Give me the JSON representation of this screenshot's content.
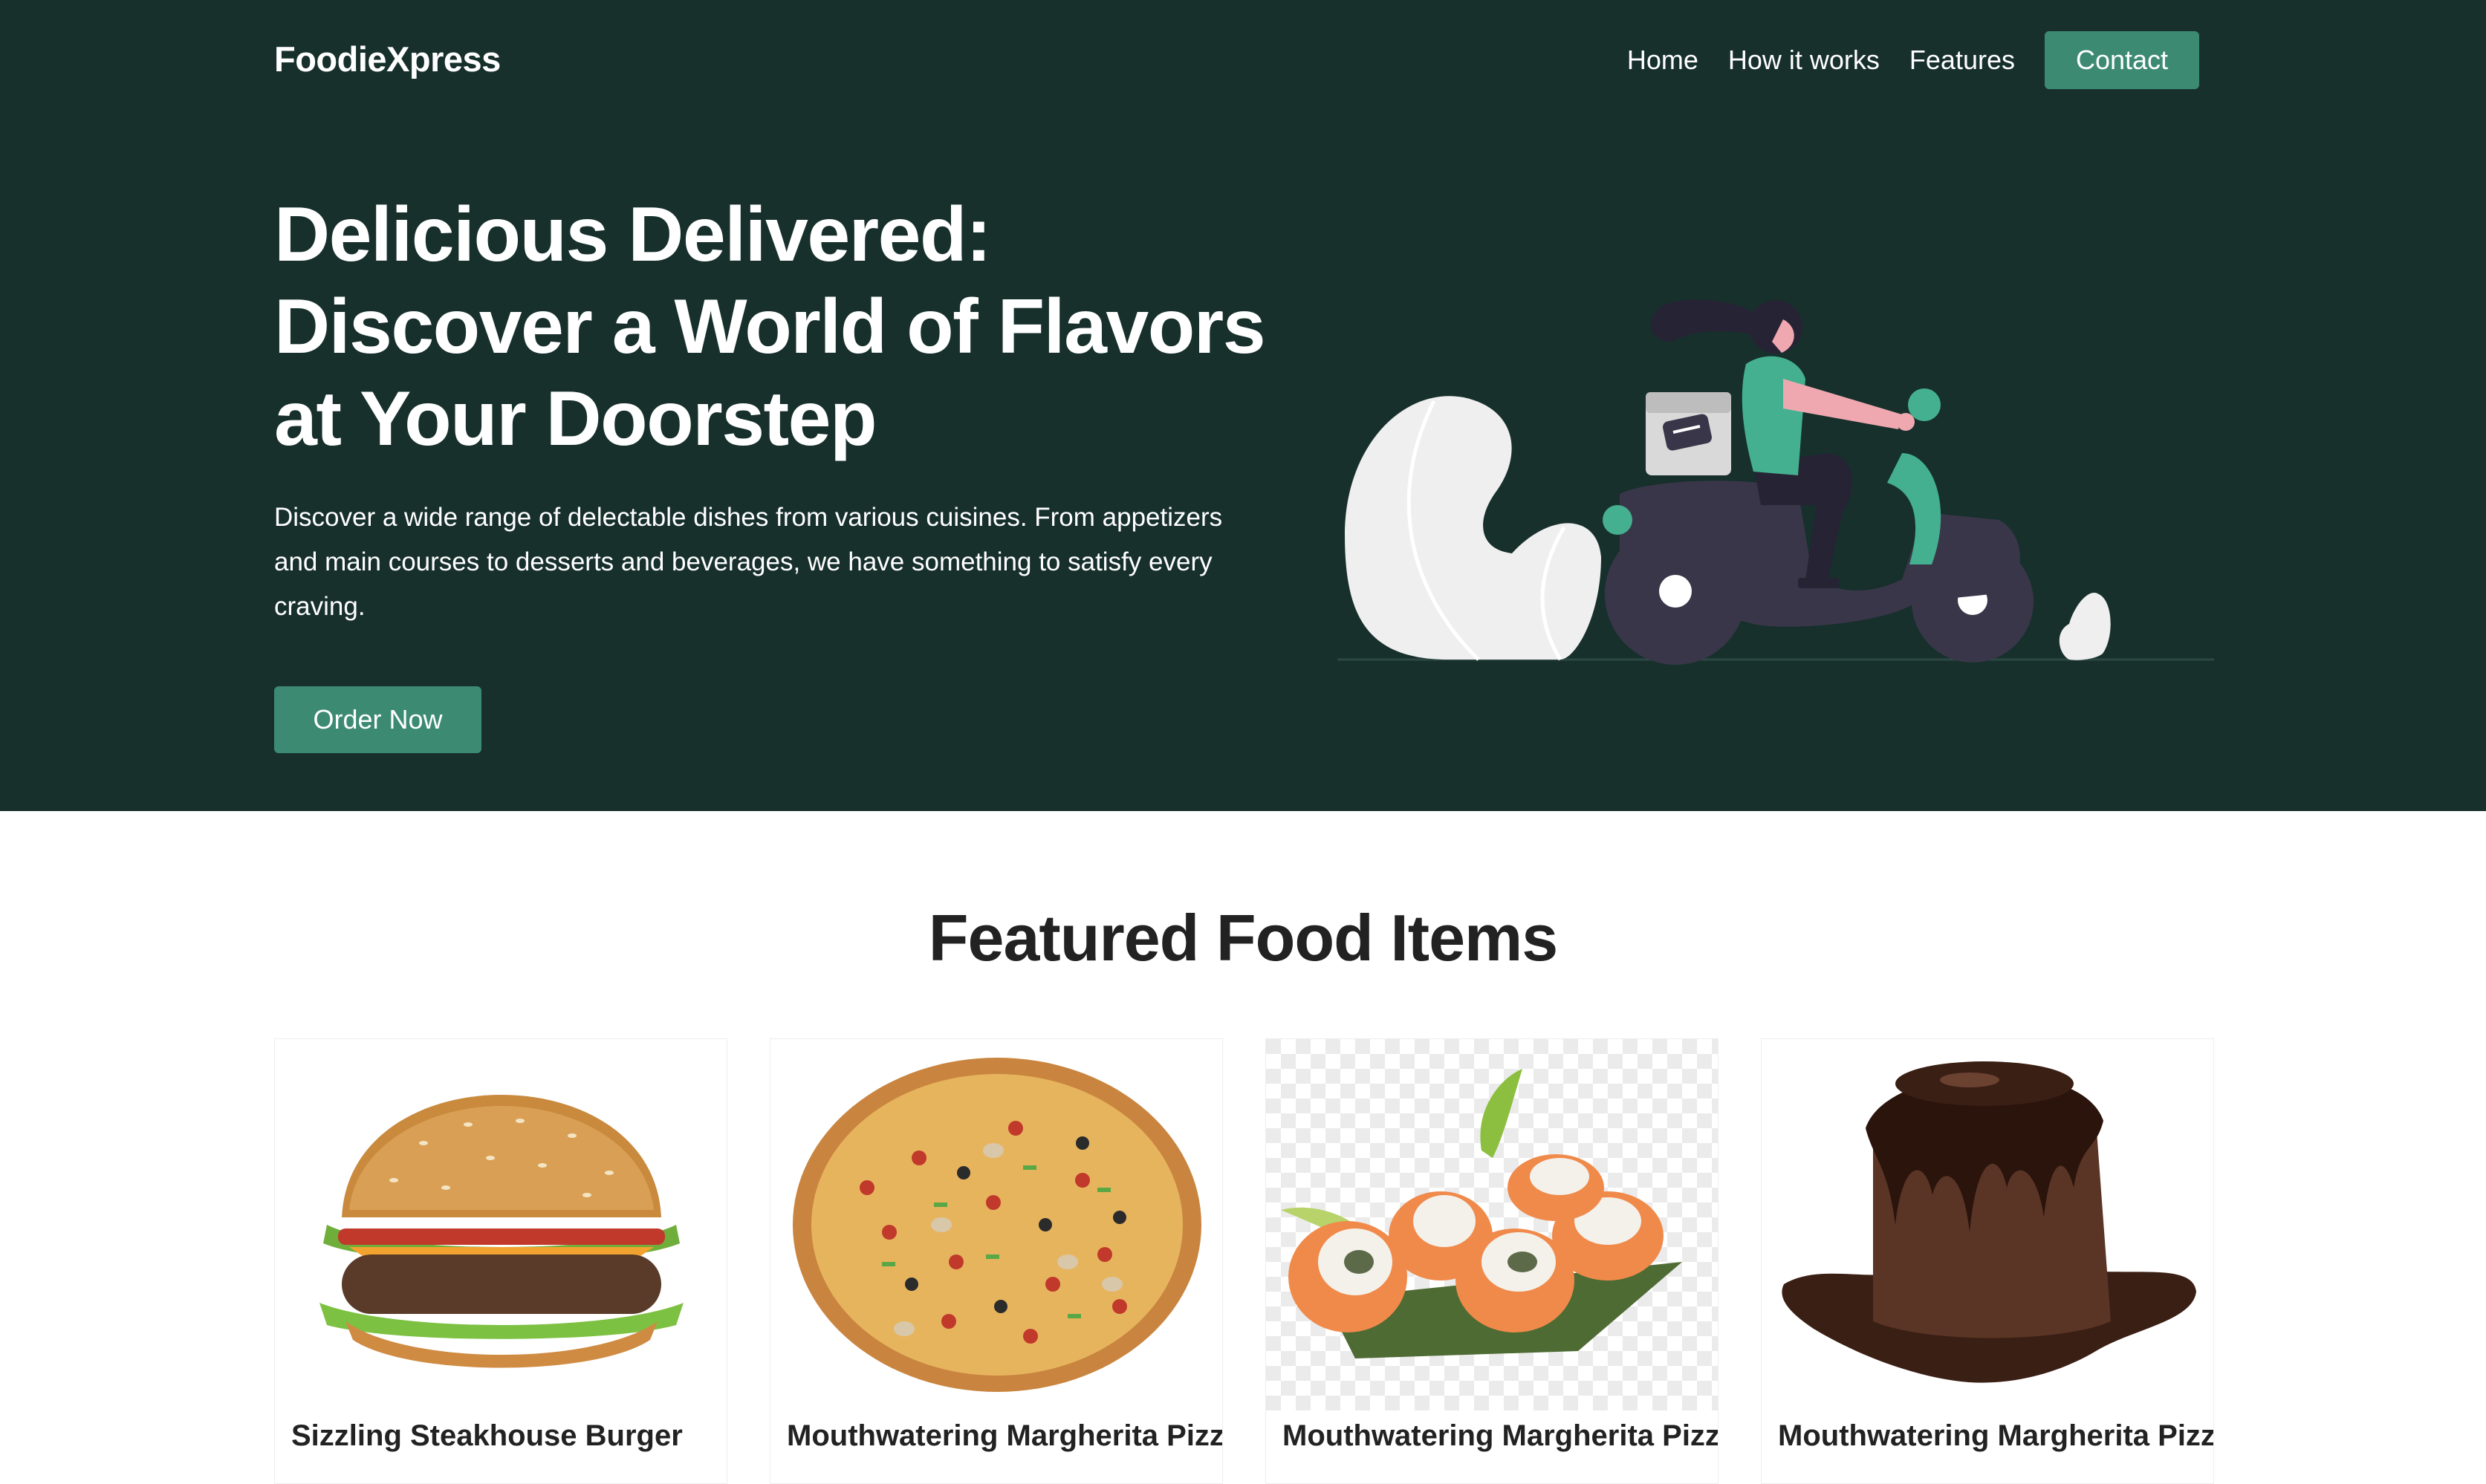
{
  "header": {
    "brand": "FoodieXpress",
    "nav": [
      "Home",
      "How it works",
      "Features"
    ],
    "contact_label": "Contact"
  },
  "hero": {
    "headline": "Delicious Delivered: Discover a World of Flavors at Your Doorstep",
    "description": "Discover a wide range of delectable dishes from various cuisines. From appetizers and main courses to desserts and beverages, we have something to satisfy every craving.",
    "cta_label": "Order Now"
  },
  "featured": {
    "title": "Featured Food Items",
    "items": [
      {
        "name": "Sizzling Steakhouse Burger",
        "image": "burger"
      },
      {
        "name": "Mouthwatering Margherita Pizza",
        "image": "pizza"
      },
      {
        "name": "Mouthwatering Margherita Pizza",
        "image": "sushi"
      },
      {
        "name": "Mouthwatering Margherita Pizza",
        "image": "lava-cake"
      }
    ]
  },
  "colors": {
    "hero_bg": "#17302c",
    "accent": "#3d8a72",
    "scooter": "#3a3649",
    "rider_shirt": "#44b08f"
  }
}
